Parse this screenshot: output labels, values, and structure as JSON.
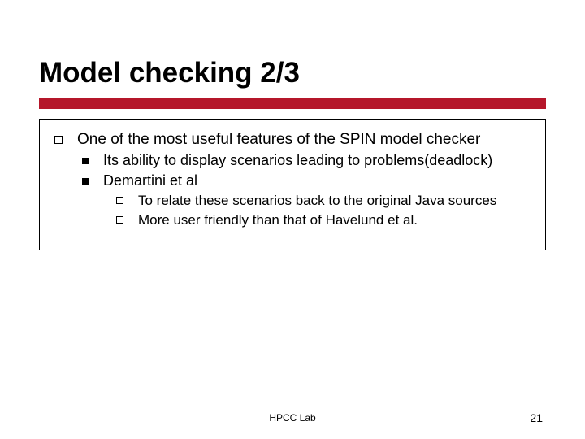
{
  "title": "Model checking 2/3",
  "bullets": {
    "l1": "One of the most useful features of the SPIN model checker",
    "l2a": "Its ability to display scenarios leading to problems(deadlock)",
    "l2b": "Demartini et al",
    "l3a": "To relate these scenarios back to the original Java sources",
    "l3b": "More user friendly than that of Havelund et al."
  },
  "footer": {
    "center": "HPCC Lab",
    "page": "21"
  }
}
